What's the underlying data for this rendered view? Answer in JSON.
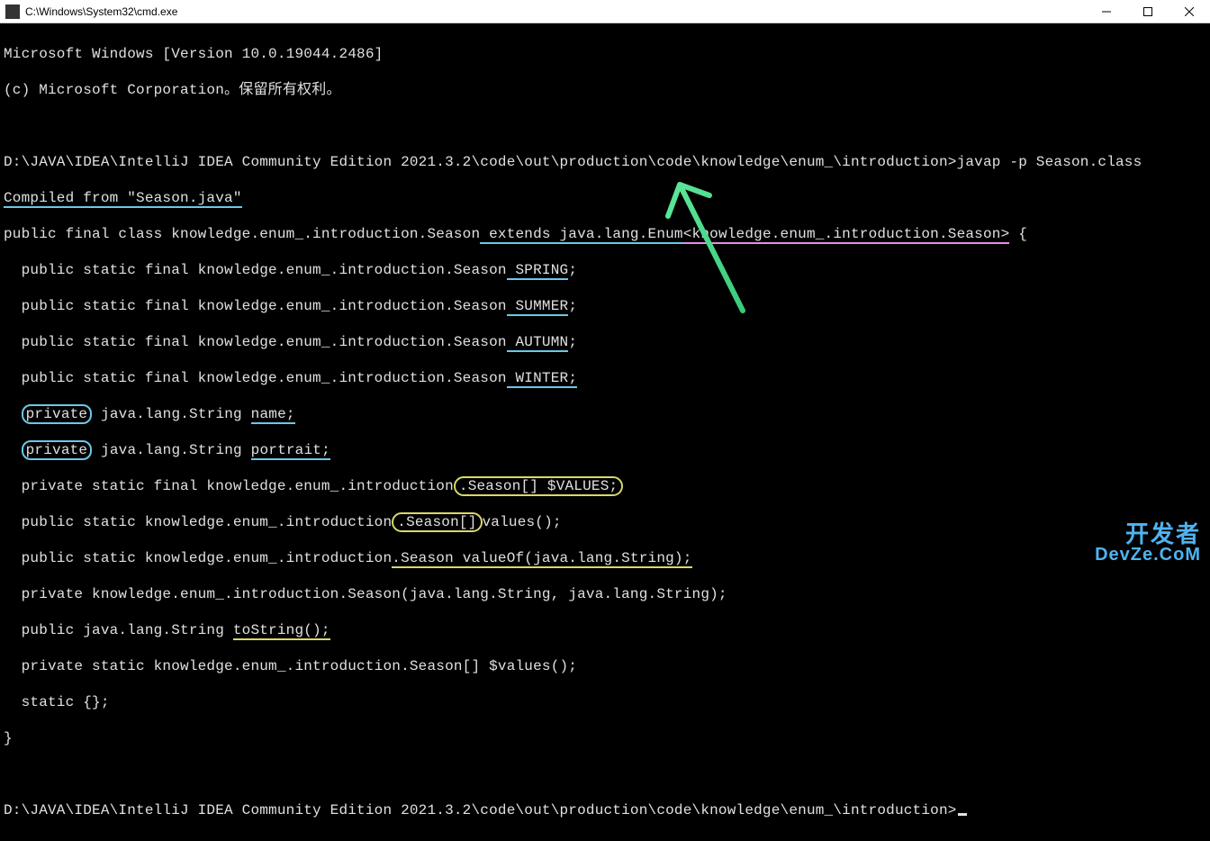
{
  "window": {
    "title": "C:\\Windows\\System32\\cmd.exe"
  },
  "header": {
    "line1": "Microsoft Windows [Version 10.0.19044.2486]",
    "line2_a": "(c) Microsoft Corporation",
    "line2_b": "。保留所有权利。"
  },
  "prompt1": {
    "path": "D:\\JAVA\\IDEA\\IntelliJ IDEA Community Edition 2021.3.2\\code\\out\\production\\code\\knowledge\\enum_\\introduction>",
    "command": "javap -p Season.class"
  },
  "output": {
    "compiled": "Compiled from \"Season.java\"",
    "class_decl_a": "public final class knowledge.enum_.introduction.Season",
    "class_decl_b": " extends java.lang.Enum",
    "class_decl_c": "<knowledge.enum_.introduction.Season>",
    "class_decl_d": " {",
    "field_spring_a": "  public static final knowledge.enum_.introduction.Season",
    "field_spring_b": " SPRING",
    "field_spring_c": ";",
    "field_summer_a": "  public static final knowledge.enum_.introduction.Season",
    "field_summer_b": " SUMMER",
    "field_summer_c": ";",
    "field_autumn_a": "  public static final knowledge.enum_.introduction.Season",
    "field_autumn_b": " AUTUMN",
    "field_autumn_c": ";",
    "field_winter_a": "  public static final knowledge.enum_.introduction.Season",
    "field_winter_b": " WINTER;",
    "field_name_a": "  ",
    "field_name_b": "private",
    "field_name_c": " java.lang.String ",
    "field_name_d": "name;",
    "field_portrait_a": "  ",
    "field_portrait_b": "private",
    "field_portrait_c": " java.lang.String ",
    "field_portrait_d": "portrait;",
    "values_a": "  private static final knowledge.enum_.introduction",
    "values_b": ".Season[] $VALUES;",
    "method_values_a": "  public static knowledge.enum_.introduction",
    "method_values_b": ".Season[]",
    "method_values_c": "values();",
    "method_valueof_a": "  public static knowledge.enum_.introduction",
    "method_valueof_b": ".Season valueOf(java.lang.String);",
    "ctor": "  private knowledge.enum_.introduction.Season(java.lang.String, java.lang.String);",
    "tostring_a": "  public java.lang.String ",
    "tostring_b": "toString();",
    "dollarvalues": "  private static knowledge.enum_.introduction.Season[] $values();",
    "static_block": "  static {};",
    "close": "}"
  },
  "prompt2": {
    "path": "D:\\JAVA\\IDEA\\IntelliJ IDEA Community Edition 2021.3.2\\code\\out\\production\\code\\knowledge\\enum_\\introduction>"
  },
  "watermark": {
    "l1": "开发者",
    "l2": "DevZe.CoM"
  }
}
